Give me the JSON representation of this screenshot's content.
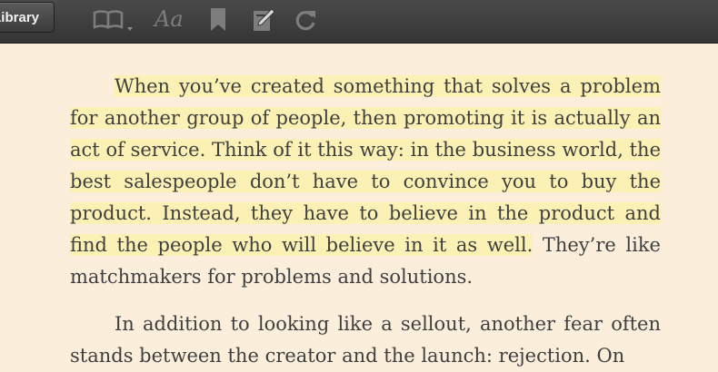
{
  "toolbar": {
    "library_label": "Library",
    "font_button_label": "Aa",
    "icons": [
      "book-icon",
      "font-icon",
      "bookmark-icon",
      "notes-icon",
      "sync-icon"
    ]
  },
  "content": {
    "paragraph1_highlighted": "When you’ve created something that solves a problem for another group of people, then promoting it is actually an act of service. Think of it this way: in the business world, the best salespeople don’t have to convince you to buy the product. Instead, they have to believe in the product and find the people who will believe in it as well.",
    "paragraph1_rest": "They’re like matchmakers for problems and solutions.",
    "paragraph2": "In addition to looking like a sellout, another fear often stands between the creator and the launch: rejection. On"
  },
  "colors": {
    "toolbar_background": "#3f3f3f",
    "page_background": "#fbeedb",
    "highlight": "#fcf1b4",
    "text": "#3f3f3f"
  }
}
